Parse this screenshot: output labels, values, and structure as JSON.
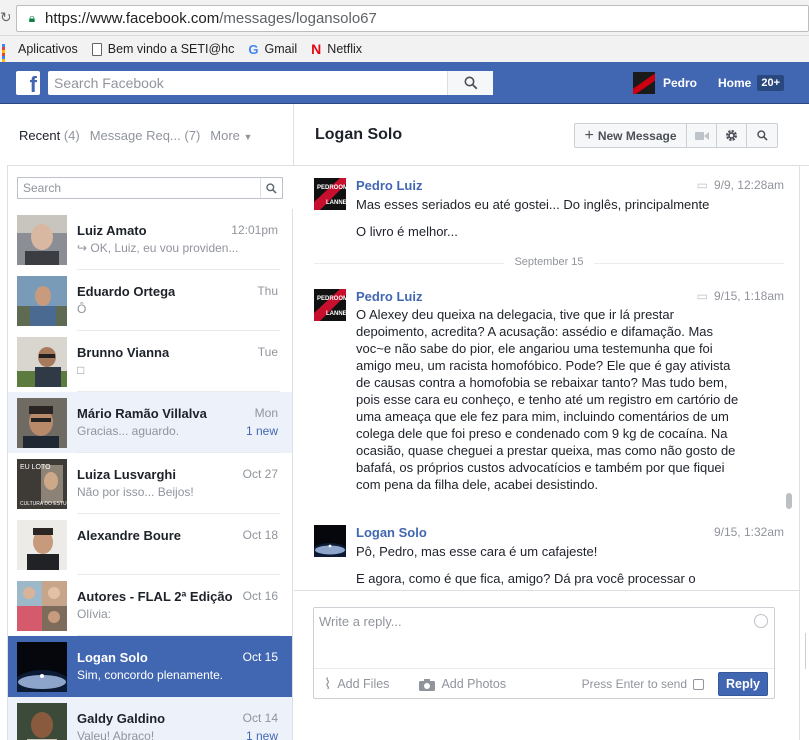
{
  "browser": {
    "url_host": "https://www.facebook.com",
    "url_path": "/messages/logansolo67",
    "bookmarks": [
      "Aplicativos",
      "Bem vindo a SETI@hc",
      "Gmail",
      "Netflix"
    ]
  },
  "topbar": {
    "search_placeholder": "Search Facebook",
    "user_name": "Pedro",
    "home_label": "Home",
    "home_badge": "20+",
    "brand_color": "#4267b2"
  },
  "left": {
    "tabs": [
      {
        "label": "Recent",
        "count": "(4)"
      },
      {
        "label": "Message Req...",
        "count": "(7)"
      },
      {
        "label": "More",
        "count": ""
      }
    ],
    "search_placeholder": "Search",
    "conversations": [
      {
        "name": "Luiz Amato",
        "time": "12:01pm",
        "snippet": "↪ OK, Luiz, eu vou providen...",
        "new": ""
      },
      {
        "name": "Eduardo Ortega",
        "time": "Thu",
        "snippet": "Ô",
        "new": ""
      },
      {
        "name": "Brunno Vianna",
        "time": "Tue",
        "snippet": "□",
        "new": ""
      },
      {
        "name": "Mário Ramão Villalva",
        "time": "Mon",
        "snippet": "Gracias... aguardo.",
        "new": "1 new"
      },
      {
        "name": "Luiza Lusvarghi",
        "time": "Oct 27",
        "snippet": "Não por isso... Beijos!",
        "new": ""
      },
      {
        "name": "Alexandre Boure",
        "time": "Oct 18",
        "snippet": "",
        "new": ""
      },
      {
        "name": "Autores - FLAL 2ª Edição",
        "time": "Oct 16",
        "snippet": "Olívia:",
        "new": ""
      },
      {
        "name": "Logan Solo",
        "time": "Oct 15",
        "snippet": "Sim, concordo plenamente.",
        "new": ""
      },
      {
        "name": "Galdy Galdino",
        "time": "Oct 14",
        "snippet": "Valeu! Abraço!",
        "new": "1 new"
      }
    ]
  },
  "thread": {
    "title": "Logan Solo",
    "new_message_label": "New Message",
    "day_separator": "September 15",
    "messages": [
      {
        "author": "Pedro Luiz",
        "time": "9/9, 12:28am",
        "lines": [
          "Mas esses seriados eu até gostei... Do inglês, principalmente",
          "O livro é melhor..."
        ]
      },
      {
        "author": "Pedro Luiz",
        "time": "9/15, 1:18am",
        "text": "O Alexey deu queixa na delegacia, tive que ir lá prestar depoimento, acredita? A acusação: assédio e difamação. Mas voc~e não sabe do pior, ele angariou uma testemunha que foi amigo meu, um racista homofóbico. Pode? Ele que é gay ativista de causas contra a homofobia se rebaixar tanto? Mas tudo bem, pois esse cara eu conheço, e tenho até um registro em cartório de uma ameaça que ele fez para mim, incluindo comentários de um colega dele que foi preso e condenado com 9 kg de cocaína. Na ocasião, quase cheguei a prestar queixa, mas como não gosto de bafafá, os próprios custos advocatícios e também por que fiquei com pena da filha dele, acabei desistindo."
      },
      {
        "author": "Logan Solo",
        "time": "9/15, 1:32am",
        "lines": [
          "Pô, Pedro, mas esse cara é um cafajeste!",
          "E agora, como é que fica, amigo? Dá pra você processar o Alexey?"
        ]
      }
    ]
  },
  "composer": {
    "placeholder": "Write a reply...",
    "add_files": "Add Files",
    "add_photos": "Add Photos",
    "press_enter": "Press Enter to send",
    "reply_button": "Reply"
  }
}
